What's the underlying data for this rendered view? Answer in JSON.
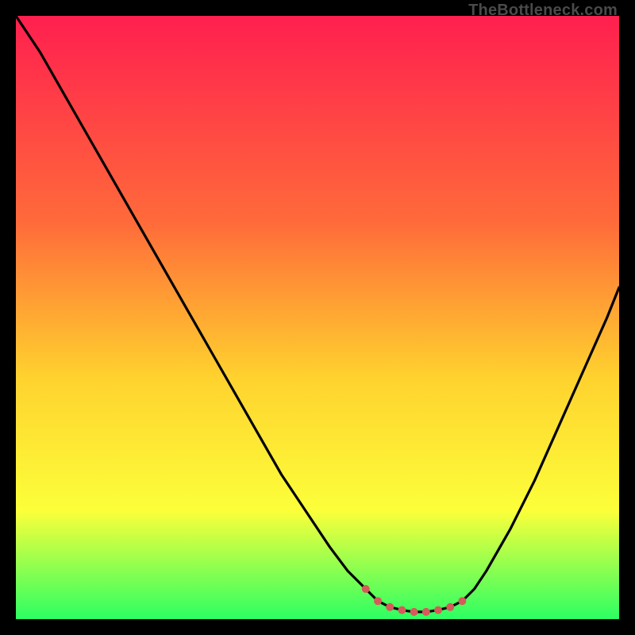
{
  "watermark": "TheBottleneck.com",
  "colors": {
    "grad_top": "#ff1f4f",
    "grad_mid1": "#ff6a3a",
    "grad_mid2": "#ffd22e",
    "grad_mid3": "#fcff3a",
    "grad_bot": "#2cff63",
    "curve": "#000000",
    "marker": "#d65a5a",
    "bg": "#000000"
  },
  "chart_data": {
    "type": "line",
    "title": "",
    "xlabel": "",
    "ylabel": "",
    "xlim": [
      0,
      100
    ],
    "ylim": [
      0,
      100
    ],
    "x": [
      0,
      4,
      8,
      12,
      16,
      20,
      24,
      28,
      32,
      36,
      40,
      44,
      48,
      52,
      55,
      58,
      60,
      62,
      64,
      66,
      68,
      70,
      72,
      74,
      76,
      78,
      82,
      86,
      90,
      94,
      98,
      100
    ],
    "values": [
      100,
      94,
      87,
      80,
      73,
      66,
      59,
      52,
      45,
      38,
      31,
      24,
      18,
      12,
      8,
      5,
      3,
      2,
      1.5,
      1.2,
      1.2,
      1.5,
      2,
      3,
      5,
      8,
      15,
      23,
      32,
      41,
      50,
      55
    ],
    "markers_x": [
      58,
      60,
      62,
      64,
      66,
      68,
      70,
      72,
      74
    ],
    "markers_y": [
      5,
      3,
      2,
      1.5,
      1.2,
      1.2,
      1.5,
      2,
      3
    ],
    "grid": false,
    "legend": false
  }
}
